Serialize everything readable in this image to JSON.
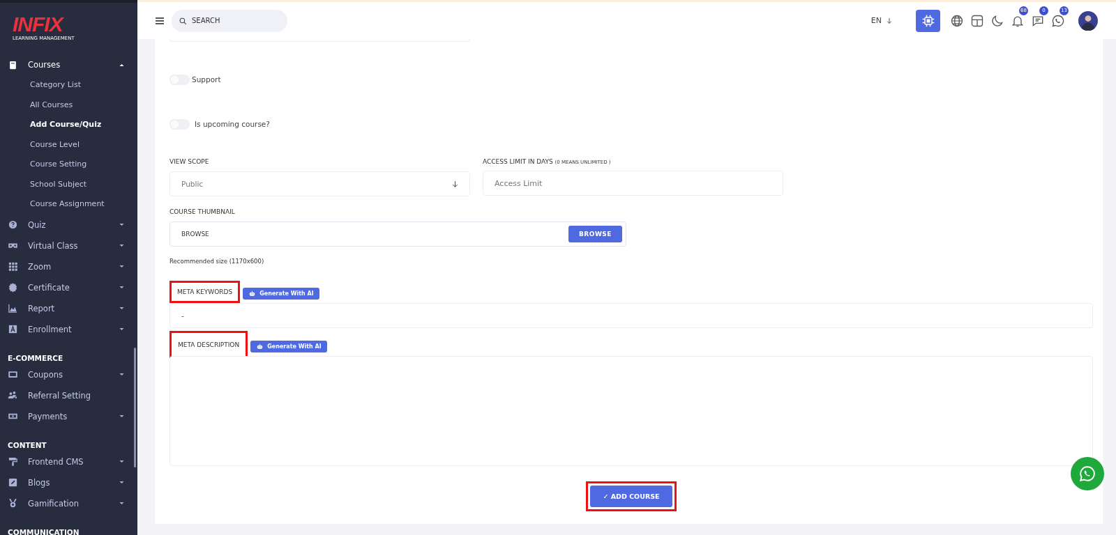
{
  "sidebar": {
    "logo": {
      "brand": "INFIX",
      "tagline": "LEARNING MANAGEMENT"
    },
    "sections": [
      {
        "items": [
          {
            "label": "Courses",
            "kind": "book",
            "expanded": true,
            "children": [
              {
                "label": "Category List",
                "selected": false
              },
              {
                "label": "All Courses",
                "selected": false
              },
              {
                "label": "Add Course/Quiz",
                "selected": true
              },
              {
                "label": "Course Level",
                "selected": false
              },
              {
                "label": "Course Setting",
                "selected": false
              },
              {
                "label": "School Subject",
                "selected": false
              },
              {
                "label": "Course Assignment",
                "selected": false
              }
            ]
          },
          {
            "label": "Quiz",
            "kind": "question",
            "expanded": false
          },
          {
            "label": "Virtual Class",
            "kind": "vr",
            "expanded": false
          },
          {
            "label": "Zoom",
            "kind": "grid",
            "expanded": false
          },
          {
            "label": "Certificate",
            "kind": "badge",
            "expanded": false
          },
          {
            "label": "Report",
            "kind": "chart",
            "expanded": false
          },
          {
            "label": "Enrollment",
            "kind": "letter",
            "expanded": false
          }
        ]
      },
      {
        "heading": "E-COMMERCE",
        "items": [
          {
            "label": "Coupons",
            "kind": "ticket",
            "expanded": false
          },
          {
            "label": "Referral Setting",
            "kind": "users"
          },
          {
            "label": "Payments",
            "kind": "money",
            "expanded": false
          }
        ]
      },
      {
        "heading": "CONTENT",
        "items": [
          {
            "label": "Frontend CMS",
            "kind": "roller",
            "expanded": false
          },
          {
            "label": "Blogs",
            "kind": "pen",
            "expanded": false
          },
          {
            "label": "Gamification",
            "kind": "medal",
            "expanded": false
          }
        ]
      },
      {
        "heading": "COMMUNICATION"
      }
    ]
  },
  "topbar": {
    "search": {
      "placeholder": "SEARCH"
    },
    "language": "EN",
    "icons": [
      {
        "kind": "ai",
        "selected": true
      },
      {
        "kind": "globe",
        "selected": false
      },
      {
        "kind": "layout",
        "selected": false
      },
      {
        "kind": "moon",
        "selected": false
      },
      {
        "kind": "bell",
        "selected": false,
        "badge": "68"
      },
      {
        "kind": "chat",
        "selected": false,
        "badge": "0"
      },
      {
        "kind": "phone",
        "selected": false,
        "badge": "13"
      }
    ]
  },
  "form": {
    "toggles": [
      {
        "label": "Support",
        "on": false
      },
      {
        "label": "Is upcoming course?",
        "on": false
      }
    ],
    "view_scope": {
      "label": "VIEW SCOPE",
      "value": "Public"
    },
    "access_limit": {
      "label": "ACCESS LIMIT IN DAYS",
      "note": "(0 MEANS UNLIMITED )",
      "placeholder": "Access Limit"
    },
    "thumbnail": {
      "label": "COURSE THUMBNAIL",
      "value": "BROWSE",
      "button": "BROWSE",
      "hint": "Recommended size (1170x600)"
    },
    "meta_keywords": {
      "label": "META KEYWORDS",
      "highlighted": true,
      "ai_button": "Generate With AI",
      "value": "-"
    },
    "meta_description": {
      "label": "META DESCRIPTION",
      "highlighted": true,
      "ai_button": "Generate With AI"
    },
    "submit": {
      "label": "ADD COURSE",
      "icon": "✓",
      "highlighted": true
    }
  }
}
